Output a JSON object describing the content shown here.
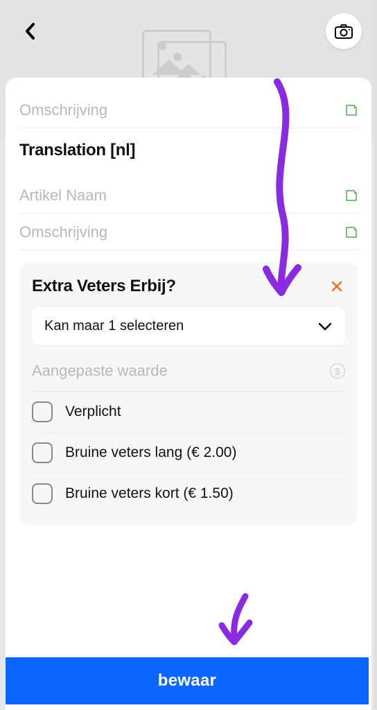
{
  "fields": {
    "omschrijving1_label": "Omschrijving",
    "translation_heading": "Translation [nl]",
    "artikel_naam_label": "Artikel Naam",
    "omschrijving2_label": "Omschrijving"
  },
  "option_group": {
    "title": "Extra Veters Erbij?",
    "dropdown_label": "Kan maar 1 selecteren",
    "aangepaste_label": "Aangepaste waarde",
    "options": [
      {
        "label": "Verplicht"
      },
      {
        "label": "Bruine veters lang (€ 2.00)"
      },
      {
        "label": "Bruine veters kort (€ 1.50)"
      }
    ],
    "currency_symbol": "$"
  },
  "save_button": "bewaar",
  "annotation_color": "#8a2be2",
  "close_color": "#e86b2b"
}
